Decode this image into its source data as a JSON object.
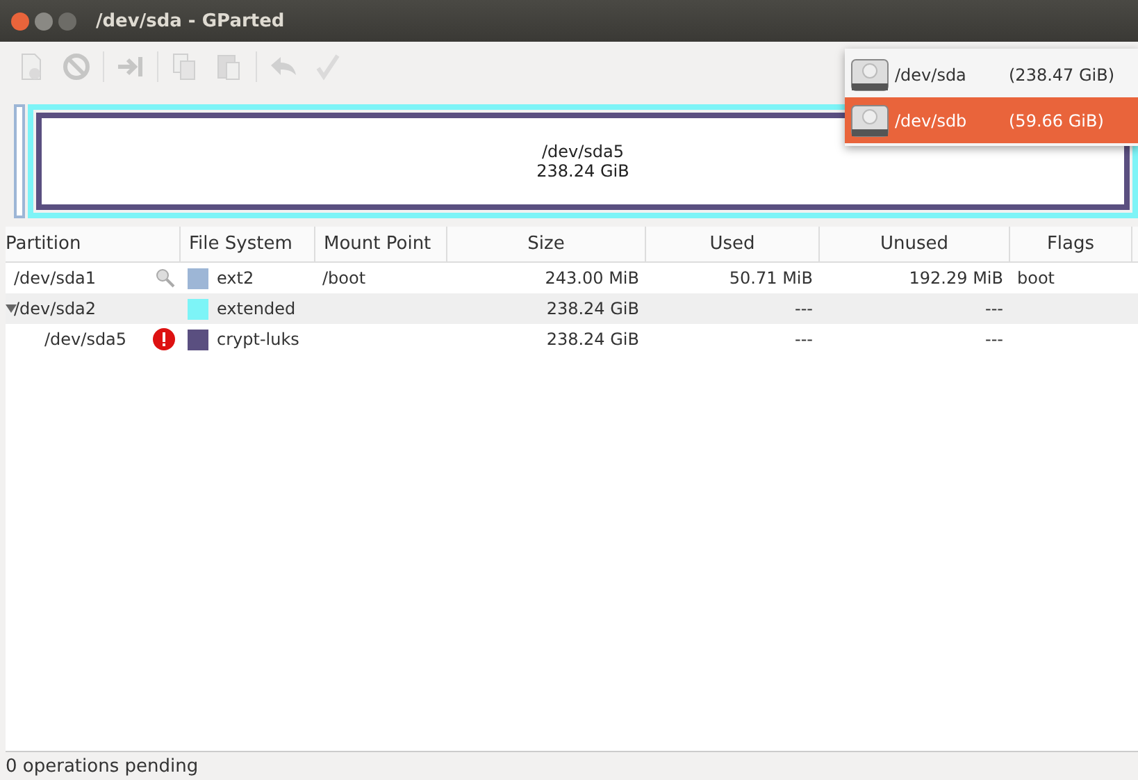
{
  "window": {
    "title": "/dev/sda - GParted"
  },
  "toolbar": [
    {
      "kind": "new",
      "disabled": true
    },
    {
      "kind": "delete",
      "disabled": true
    },
    {
      "kind": "separator"
    },
    {
      "kind": "resize",
      "disabled": true
    },
    {
      "kind": "separator"
    },
    {
      "kind": "copy",
      "disabled": true
    },
    {
      "kind": "paste",
      "disabled": true
    },
    {
      "kind": "separator"
    },
    {
      "kind": "undo",
      "disabled": true
    },
    {
      "kind": "apply",
      "disabled": true
    }
  ],
  "devices": [
    {
      "name": "/dev/sda",
      "size": "(238.47 GiB)",
      "selected": false
    },
    {
      "name": "/dev/sdb",
      "size": "(59.66 GiB)",
      "selected": true
    }
  ],
  "disk_map": {
    "label": "/dev/sda5",
    "size": "238.24 GiB"
  },
  "table": {
    "columns": [
      "Partition",
      "File System",
      "Mount Point",
      "Size",
      "Used",
      "Unused",
      "Flags"
    ],
    "rows": [
      {
        "partition": "/dev/sda1",
        "mounted": true,
        "error": false,
        "filesystem": "ext2",
        "color": "#9db6d6",
        "mount": "/boot",
        "size": "243.00 MiB",
        "used": "50.71 MiB",
        "unused": "192.29 MiB",
        "flags": "boot"
      },
      {
        "partition": "/dev/sda2",
        "mounted": false,
        "error": false,
        "filesystem": "extended",
        "color": "#7df4f7",
        "size": "238.24 GiB",
        "used": "---",
        "unused": "---",
        "expanded": true,
        "children": [
          {
            "partition": "/dev/sda5",
            "mounted": false,
            "error": true,
            "filesystem": "crypt-luks",
            "color": "#5a4f80",
            "size": "238.24 GiB",
            "used": "---",
            "unused": "---"
          }
        ]
      }
    ]
  },
  "status_bar": "0 operations pending"
}
